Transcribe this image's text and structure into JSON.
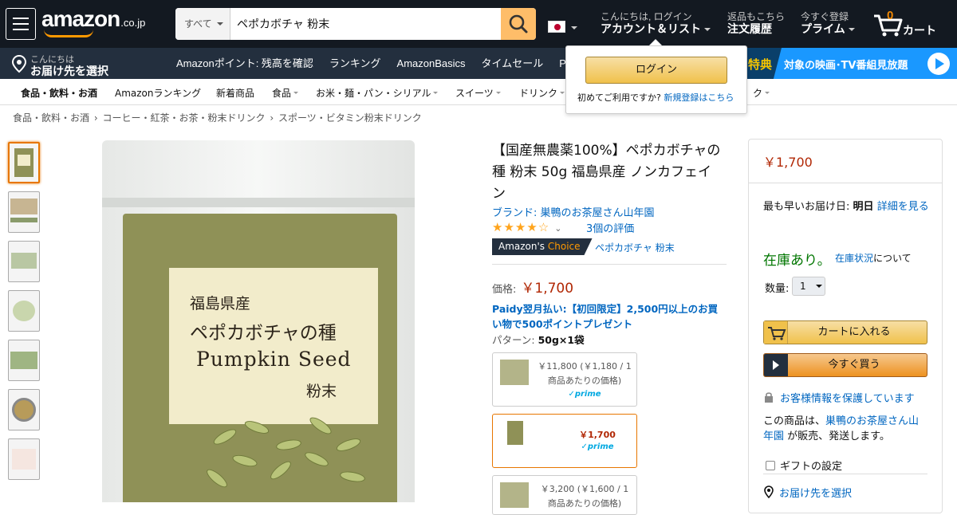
{
  "header": {
    "logo_text": "amazon",
    "logo_tld": ".co.jp",
    "search_category": "すべて",
    "search_query": "ペポカボチャ 粉末",
    "greeting": "こんにちは, ログイン",
    "account_label": "アカウント＆リスト",
    "returns_line1": "返品もこちら",
    "orders_label": "注文履歴",
    "prime_line1": "今すぐ登録",
    "prime_label": "プライム",
    "cart_count": "0",
    "cart_label": "カート"
  },
  "subnav": {
    "deliver_line1": "こんにちは",
    "deliver_line2": "お届け先を選択",
    "links": [
      "Amazonポイント: 残高を確認",
      "ランキング",
      "AmazonBasics",
      "タイムセール",
      "P"
    ],
    "promo_lead": "特典",
    "promo_text": "対象の映画･TV番組見放題"
  },
  "login_flyout": {
    "button": "ログイン",
    "new_customer": "初めてご利用ですか?",
    "register_link": "新規登録はこちら"
  },
  "category_bar": [
    "食品・飲料・お酒",
    "Amazonランキング",
    "新着商品",
    "食品",
    "お米・麺・パン・シリアル",
    "スイーツ",
    "ドリンク",
    "ク"
  ],
  "breadcrumb": [
    "食品・飲料・お酒",
    "›",
    "コーヒー・紅茶・お茶・粉末ドリンク",
    "›",
    "スポーツ・ビタミン粉末ドリンク"
  ],
  "product": {
    "title": "【国産無農薬100%】ペポカボチャの種 粉末 50g 福島県産 ノンカフェイン",
    "brand": "ブランド: 巣鴨のお茶屋さん山年園",
    "rating_stars": "★★★★☆",
    "rating_value": 4,
    "ratings_count": "3個の評価",
    "choice_badge_a": "Amazon's",
    "choice_badge_b": "Choice",
    "choice_term": "ペポカボチャ 粉末",
    "price_label": "価格:",
    "price": "￥1,700",
    "paidy": "Paidy翌月払い:【初回限定】2,500円以上のお買い物で500ポイントプレゼント",
    "pattern_label": "パターン:",
    "pattern_value": "50g×1袋",
    "image_label": {
      "line1": "福島県産",
      "line2": "ペポカボチャの種",
      "line3": "Pumpkin Seed",
      "line4": "粉末"
    },
    "options": [
      {
        "price": "￥11,800 (￥1,180 / 1商品あたりの価格)",
        "prime": "✓prime"
      },
      {
        "price": "￥1,700",
        "prime": "✓prime"
      },
      {
        "price": "￥3,200 (￥1,600 / 1商品あたりの価格)",
        "prime": ""
      }
    ]
  },
  "buybox": {
    "price": "￥1,700",
    "delivery_prefix": "最も早いお届け日:",
    "delivery_day": "明日",
    "delivery_link": "詳細を見る",
    "stock": "在庫あり。",
    "stock_link": "在庫状況",
    "stock_suffix": "について",
    "qty_label": "数量:",
    "qty_value": "1",
    "add_to_cart": "カートに入れる",
    "buy_now": "今すぐ買う",
    "secure": "お客様情報を保護しています",
    "seller_prefix": "この商品は、",
    "seller_name": "巣鴨のお茶屋さん山年園",
    "seller_suffix": "が販売、発送します。",
    "gift": "ギフトの設定",
    "ship_to": "お届け先を選択"
  },
  "colors": {
    "header_bg": "#131921",
    "subnav_bg": "#232f3e",
    "accent_orange": "#febd69",
    "price_red": "#b12704",
    "stock_green": "#007600",
    "link_blue": "#0066c0"
  }
}
